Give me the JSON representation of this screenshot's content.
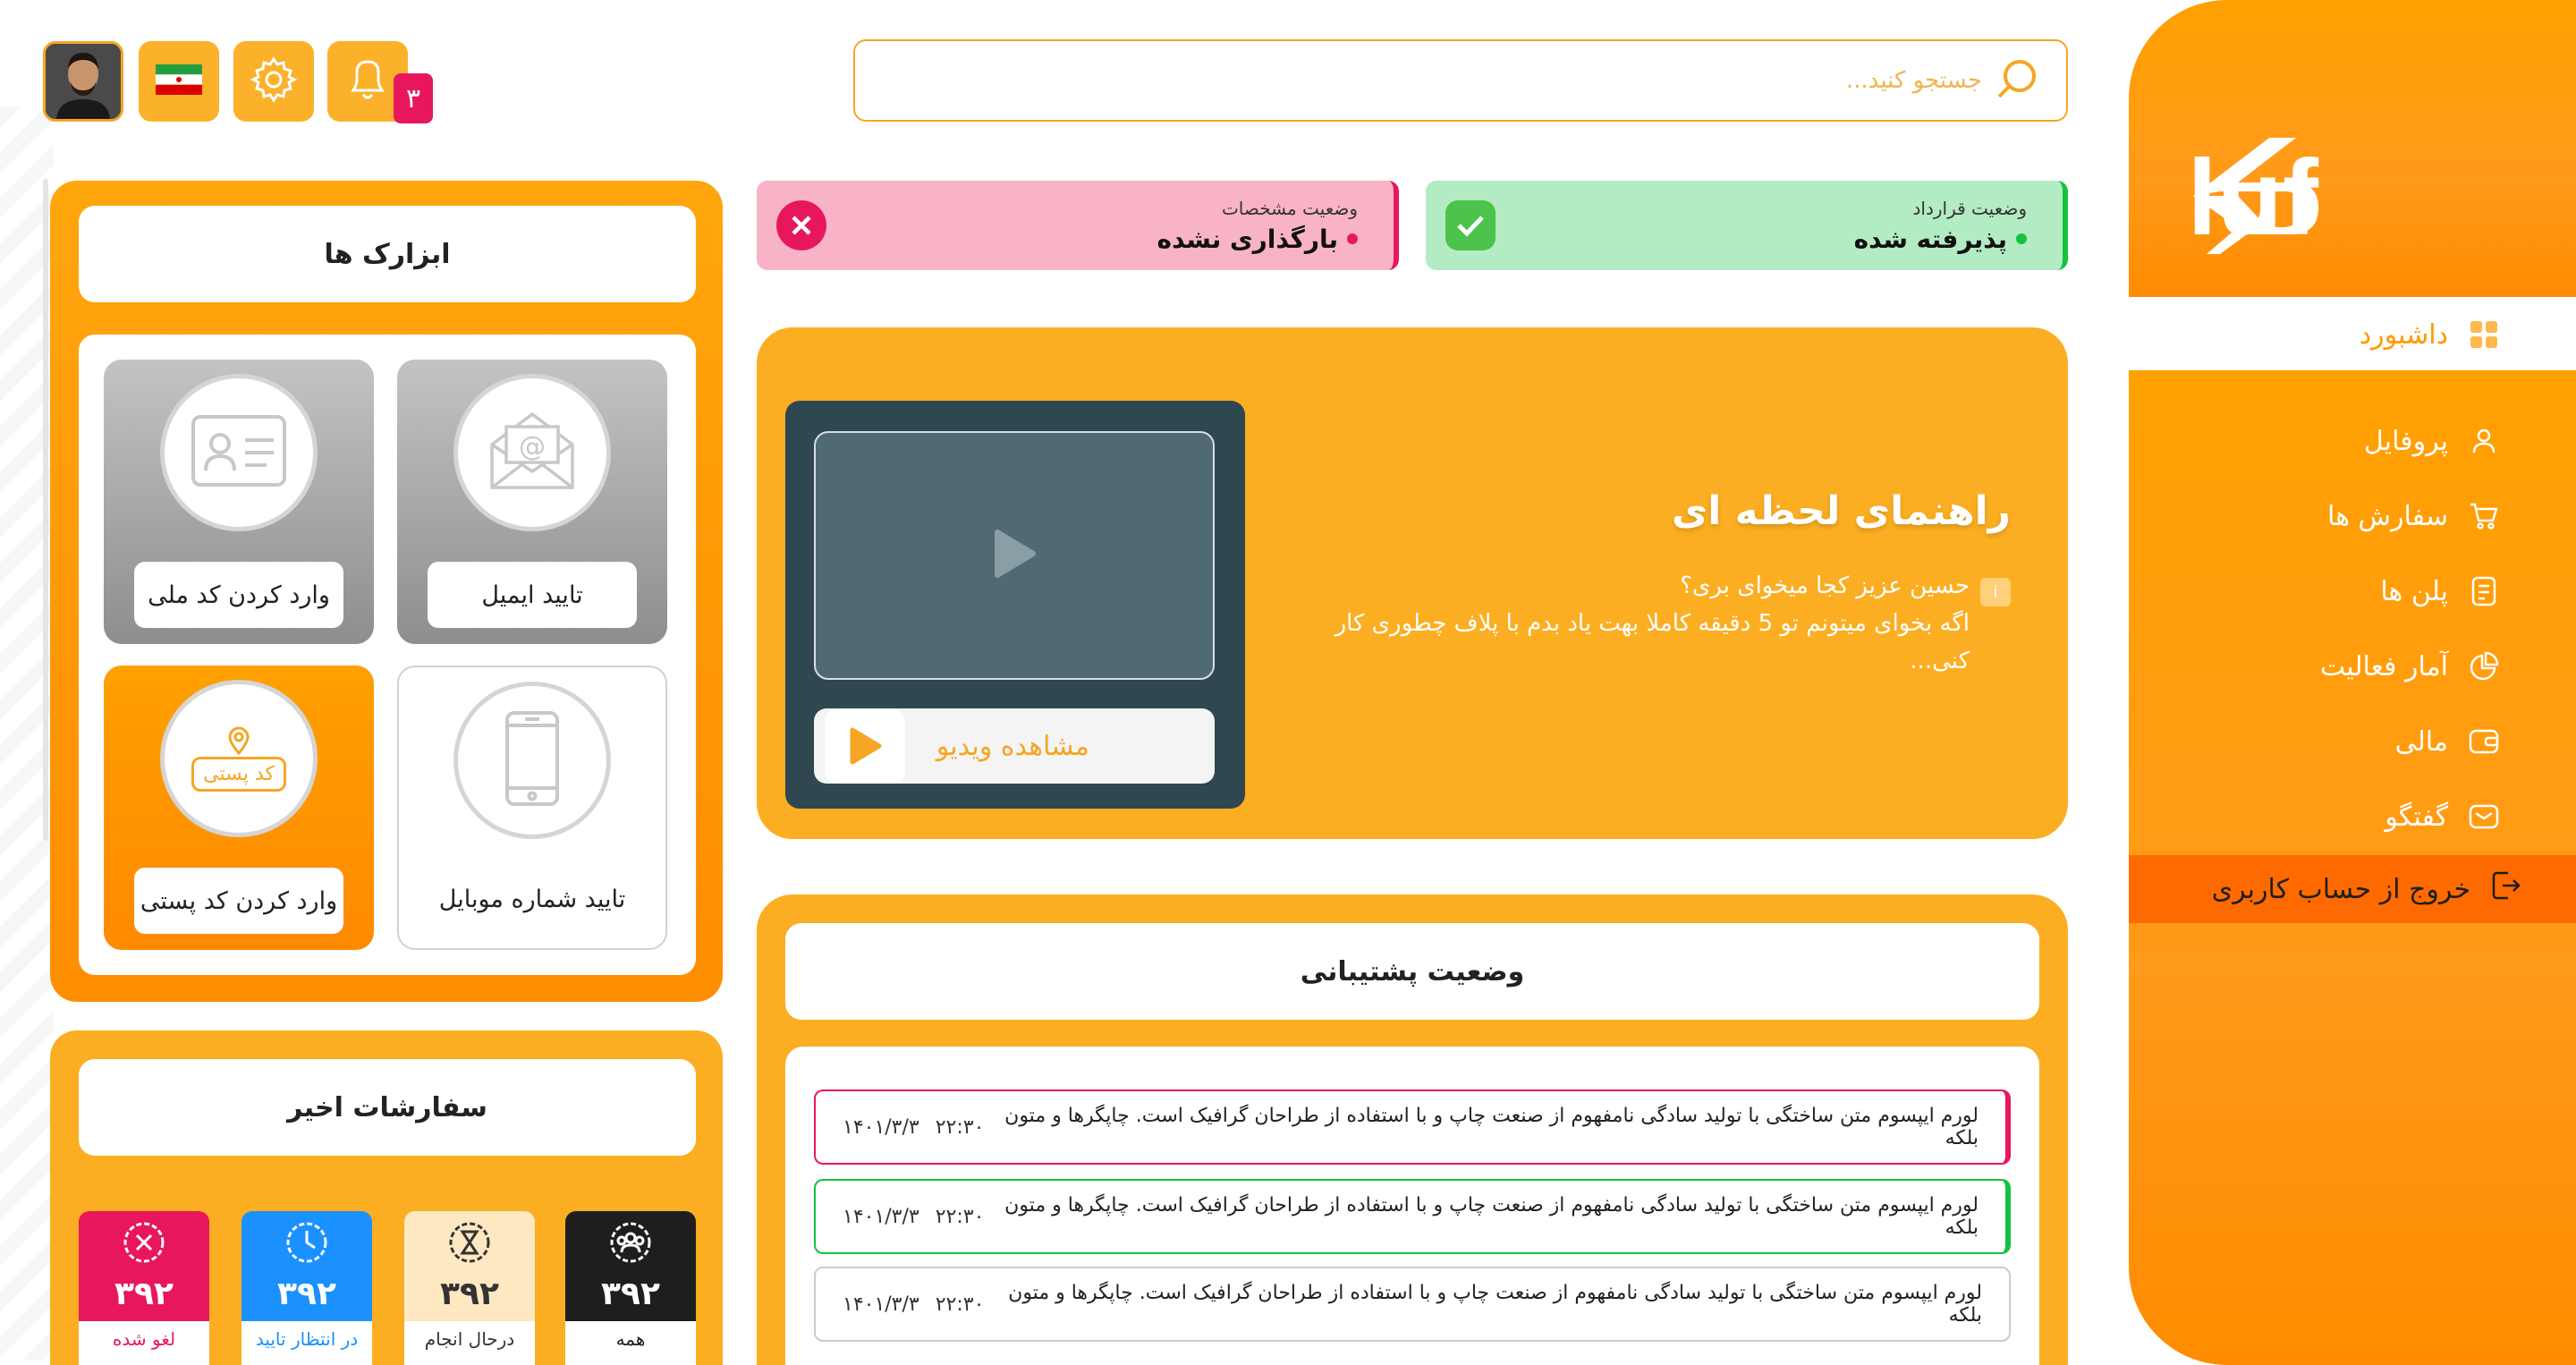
{
  "sidebar": {
    "logo_text": "Pluf",
    "items": [
      {
        "label": "داشبورد",
        "icon": "dashboard-icon",
        "active": true
      },
      {
        "label": "پروفایل",
        "icon": "user-icon"
      },
      {
        "label": "سفارش ها",
        "icon": "cart-icon"
      },
      {
        "label": "پلن ها",
        "icon": "document-icon"
      },
      {
        "label": "آمار فعالیت",
        "icon": "pie-chart-icon"
      },
      {
        "label": "مالی",
        "icon": "wallet-icon"
      },
      {
        "label": "گفتگو",
        "icon": "message-icon"
      }
    ],
    "logout_label": "خروج از حساب کاربری"
  },
  "header": {
    "search_placeholder": "جستجو کنید...",
    "notification_count": "۳"
  },
  "status": {
    "contract": {
      "label": "وضعیت قرارداد",
      "value": "پذیرفته شده",
      "color": "#b3ebc3",
      "accent": "#14c240"
    },
    "specs": {
      "label": "وضعیت مشخصات",
      "value": "بارگذاری نشده",
      "color": "#f9b3c6",
      "accent": "#e8175d"
    }
  },
  "guide": {
    "title": "راهنمای لحظه ای",
    "info": "i",
    "text_line1": "حسین عزیز کجا میخوای بری؟",
    "text_line2": "اگه بخوای میتونم تو 5 دقیقه کاملا بهت یاد بدم با پلاف چطوری کار کنی...",
    "watch_label": "مشاهده ویدیو"
  },
  "support": {
    "title": "وضعیت پشتیبانی",
    "tickets": [
      {
        "text": "لورم ایپسوم متن ساختگی با تولید سادگی نامفهوم از صنعت چاپ و با استفاده از طراحان گرافیک است. چاپگرها و متون بلکه",
        "time": "۲۲:۳۰",
        "date": "۱۴۰۱/۳/۳",
        "border": "#e8175d"
      },
      {
        "text": "لورم ایپسوم متن ساختگی با تولید سادگی نامفهوم از صنعت چاپ و با استفاده از طراحان گرافیک است. چاپگرها و متون بلکه",
        "time": "۲۲:۳۰",
        "date": "۱۴۰۱/۳/۳",
        "border": "#14c240"
      },
      {
        "text": "لورم ایپسوم متن ساختگی با تولید سادگی نامفهوم از صنعت چاپ و با استفاده از طراحان گرافیک است. چاپگرها و متون بلکه",
        "time": "۲۲:۳۰",
        "date": "۱۴۰۱/۳/۳",
        "border": "#cccccc"
      }
    ]
  },
  "tools": {
    "title": "ابزارک ها",
    "tiles": [
      {
        "label": "تایید ایمیل",
        "icon": "email-icon"
      },
      {
        "label": "وارد کردن کد ملی",
        "icon": "id-card-icon"
      },
      {
        "label": "تایید شماره موبایل",
        "icon": "mobile-icon"
      },
      {
        "label": "وارد کردن کد پستی",
        "icon": "postal-code-icon",
        "badge": "کد پستی"
      }
    ]
  },
  "orders": {
    "title": "سفارشات اخیر",
    "tiles": [
      {
        "count": "۳۹۲",
        "label": "همه",
        "icon": "group-icon",
        "color": "#1e1e1e"
      },
      {
        "count": "۳۹۲",
        "label": "درحال انجام",
        "icon": "hourglass-icon",
        "color": "#fde8c2"
      },
      {
        "count": "۳۹۲",
        "label": "در انتظار تایید",
        "icon": "clock-icon",
        "color": "#1a91ff"
      },
      {
        "count": "۳۹۲",
        "label": "لغو شده",
        "icon": "cancel-icon",
        "color": "#e8175d"
      }
    ]
  }
}
